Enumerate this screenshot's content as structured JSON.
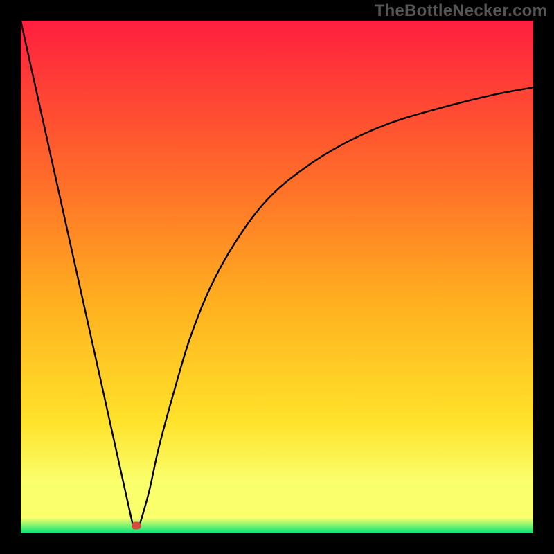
{
  "watermark": "TheBottleNecker.com",
  "colors": {
    "frame_bg": "#000000",
    "gradient_top": "#ff1f3f",
    "gradient_mid1": "#ff6a2a",
    "gradient_mid2": "#ffb01f",
    "gradient_mid3": "#ffe22a",
    "gradient_band": "#faff6c",
    "gradient_bottom": "#00e676",
    "curve": "#000000",
    "marker": "#d64a3f"
  },
  "chart_data": {
    "type": "line",
    "title": "",
    "xlabel": "",
    "ylabel": "",
    "xlim": [
      0,
      100
    ],
    "ylim": [
      0,
      100
    ],
    "legend": false,
    "grid": false,
    "marker_point": {
      "x": 22.5,
      "y": 1.5,
      "color": "#d64a3f"
    },
    "series": [
      {
        "name": "left-branch",
        "x": [
          0,
          2,
          4,
          6,
          8,
          10,
          12,
          14,
          16,
          18,
          20,
          21,
          22
        ],
        "y": [
          100,
          91,
          82,
          73,
          64,
          55,
          46,
          37,
          28,
          19,
          10,
          5.5,
          1
        ]
      },
      {
        "name": "right-branch",
        "x": [
          23,
          25,
          27,
          30,
          33,
          37,
          42,
          48,
          55,
          63,
          72,
          82,
          92,
          100
        ],
        "y": [
          1,
          8,
          17,
          28,
          38,
          48,
          57,
          65,
          71,
          76,
          80,
          83,
          85.5,
          87
        ]
      }
    ],
    "annotations": []
  }
}
